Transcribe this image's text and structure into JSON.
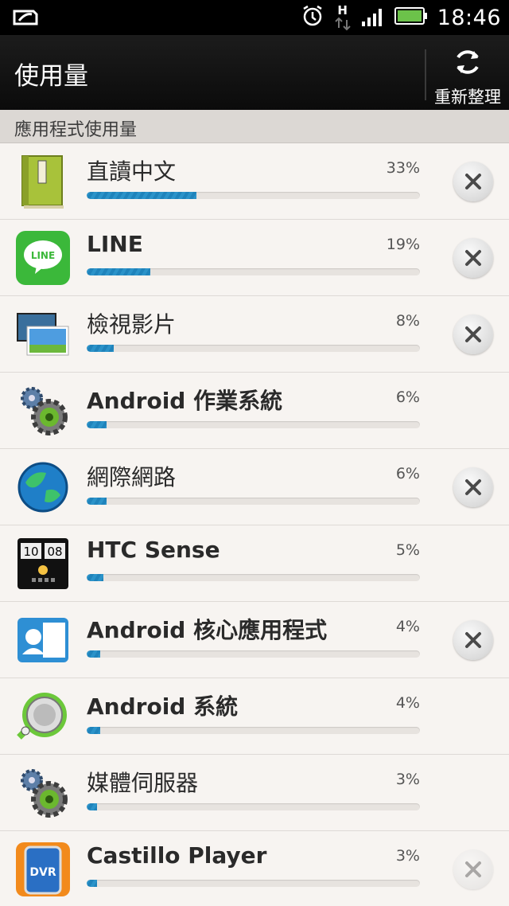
{
  "status_bar": {
    "time": "18:46",
    "network_type": "H",
    "icons": [
      "notification-icon",
      "alarm-icon",
      "data-arrows-icon",
      "signal-icon",
      "battery-icon"
    ]
  },
  "action_bar": {
    "title": "使用量",
    "refresh_label": "重新整理"
  },
  "section": {
    "label": "應用程式使用量"
  },
  "apps": [
    {
      "name": "直讀中文",
      "percent": "33%",
      "usage": 0.33,
      "icon": "book-icon",
      "latin": false,
      "closable": true
    },
    {
      "name": "LINE",
      "percent": "19%",
      "usage": 0.19,
      "icon": "line-icon",
      "latin": true,
      "closable": true
    },
    {
      "name": "檢視影片",
      "percent": "8%",
      "usage": 0.08,
      "icon": "video-icon",
      "latin": false,
      "closable": true
    },
    {
      "name": "Android 作業系統",
      "percent": "6%",
      "usage": 0.06,
      "icon": "gears-icon",
      "latin": true,
      "closable": false
    },
    {
      "name": "網際網路",
      "percent": "6%",
      "usage": 0.06,
      "icon": "globe-icon",
      "latin": false,
      "closable": true
    },
    {
      "name": "HTC Sense",
      "percent": "5%",
      "usage": 0.05,
      "icon": "htc-clock-icon",
      "latin": true,
      "closable": false
    },
    {
      "name": "Android 核心應用程式",
      "percent": "4%",
      "usage": 0.04,
      "icon": "contacts-icon",
      "latin": true,
      "closable": true
    },
    {
      "name": "Android 系統",
      "percent": "4%",
      "usage": 0.04,
      "icon": "android-system-icon",
      "latin": true,
      "closable": false
    },
    {
      "name": "媒體伺服器",
      "percent": "3%",
      "usage": 0.03,
      "icon": "gears-icon",
      "latin": false,
      "closable": false
    },
    {
      "name": "Castillo Player",
      "percent": "3%",
      "usage": 0.03,
      "icon": "dvr-icon",
      "latin": true,
      "closable": true,
      "close_dimmed": true
    }
  ]
}
